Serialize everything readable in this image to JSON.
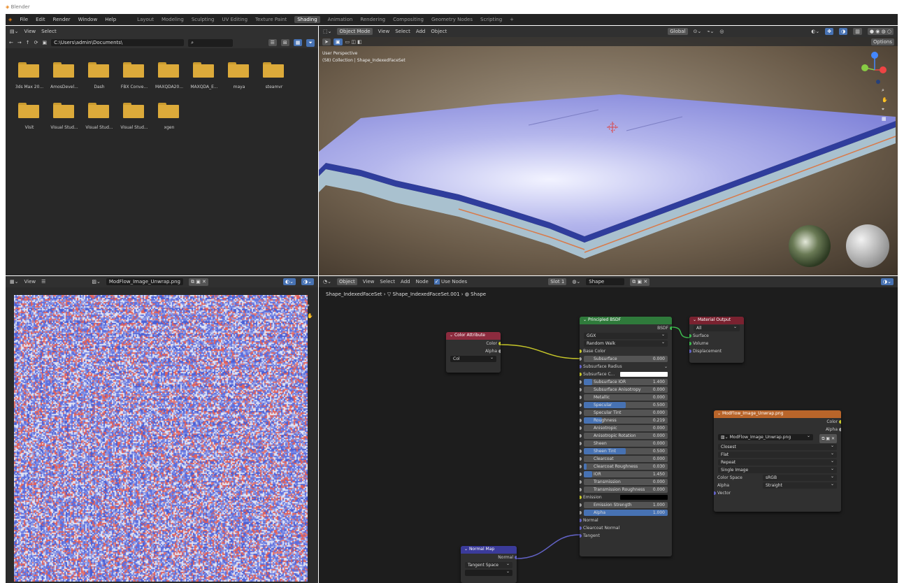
{
  "titlebar": {
    "title": "Blender"
  },
  "menubar": {
    "menus": [
      "File",
      "Edit",
      "Render",
      "Window",
      "Help"
    ],
    "workspaces": [
      "Layout",
      "Modeling",
      "Sculpting",
      "UV Editing",
      "Texture Paint",
      "Shading",
      "Animation",
      "Rendering",
      "Compositing",
      "Geometry Nodes",
      "Scripting",
      "+"
    ],
    "active_workspace": "Shading"
  },
  "file_browser": {
    "header": [
      "View",
      "Select"
    ],
    "path": "C:\\Users\\admin\\Documents\\",
    "folders": [
      "3ds Max 20...",
      "AmosDevel...",
      "Dash",
      "FBX Conve...",
      "MAXQDA20...",
      "MAXQDA_E...",
      "maya",
      "steamvr",
      "Visit",
      "Visual Stud...",
      "Visual Stud...",
      "Visual Stud...",
      "xgen"
    ]
  },
  "viewport": {
    "header": [
      "Object Mode",
      "View",
      "Select",
      "Add",
      "Object"
    ],
    "orientation": "Global",
    "options_label": "Options",
    "overlay_line1": "User Perspective",
    "overlay_line2": "(58) Collection | Shape_IndexedFaceSet",
    "gizmo_axes": [
      "X",
      "Y",
      "Z"
    ]
  },
  "image_editor": {
    "header_view": "View",
    "image_name": "ModFlow_Image_Unwrap.png"
  },
  "node_editor": {
    "header": [
      "Object",
      "View",
      "Select",
      "Add",
      "Node"
    ],
    "use_nodes_label": "Use Nodes",
    "slot": "Slot 1",
    "material": "Shape",
    "breadcrumb": [
      "Shape_IndexedFaceSet",
      "Shape_IndexedFaceSet.001",
      "Shape"
    ],
    "color_attribute": {
      "title": "Color Attribute",
      "outputs": [
        "Color",
        "Alpha"
      ],
      "field": "Col"
    },
    "principled": {
      "title": "Principled BSDF",
      "output": "BSDF",
      "dropdowns": [
        "GGX",
        "Random Walk"
      ],
      "base_color": "Base Color",
      "subsurface_radius": "Subsurface Radius",
      "subsurface_color": "Subsurface C...",
      "params": [
        {
          "label": "Subsurface",
          "value": "0.000",
          "fill": 0
        },
        {
          "label": "Subsurface IOR",
          "value": "1.400",
          "fill": 0.1
        },
        {
          "label": "Subsurface Anisotropy",
          "value": "0.000",
          "fill": 0
        },
        {
          "label": "Metallic",
          "value": "0.000",
          "fill": 0
        },
        {
          "label": "Specular",
          "value": "0.500",
          "fill": 0.5
        },
        {
          "label": "Specular Tint",
          "value": "0.000",
          "fill": 0
        },
        {
          "label": "Roughness",
          "value": "0.219",
          "fill": 0.22
        },
        {
          "label": "Anisotropic",
          "value": "0.000",
          "fill": 0
        },
        {
          "label": "Anisotropic Rotation",
          "value": "0.000",
          "fill": 0
        },
        {
          "label": "Sheen",
          "value": "0.000",
          "fill": 0
        },
        {
          "label": "Sheen Tint",
          "value": "0.500",
          "fill": 0.5
        },
        {
          "label": "Clearcoat",
          "value": "0.000",
          "fill": 0
        },
        {
          "label": "Clearcoat Roughness",
          "value": "0.030",
          "fill": 0.03
        },
        {
          "label": "IOR",
          "value": "1.450",
          "fill": 0.1
        },
        {
          "label": "Transmission",
          "value": "0.000",
          "fill": 0
        },
        {
          "label": "Transmission Roughness",
          "value": "0.000",
          "fill": 0
        }
      ],
      "emission": "Emission",
      "emission_strength": {
        "label": "Emission Strength",
        "value": "1.000",
        "fill": 0
      },
      "alpha": {
        "label": "Alpha",
        "value": "1.000",
        "fill": 1
      },
      "inputs_bottom": [
        "Normal",
        "Clearcoat Normal",
        "Tangent"
      ]
    },
    "material_output": {
      "title": "Material Output",
      "target": "All",
      "inputs": [
        "Surface",
        "Volume",
        "Displacement"
      ]
    },
    "image_texture": {
      "title": "ModFlow_Image_Unwrap.png",
      "outputs": [
        "Color",
        "Alpha"
      ],
      "image": "ModFlow_Image_Unwrap.png",
      "dropdowns": [
        "Closest",
        "Flat",
        "Repeat",
        "Single Image"
      ],
      "color_space_label": "Color Space",
      "color_space": "sRGB",
      "alpha_label": "Alpha",
      "alpha": "Straight",
      "vector": "Vector"
    },
    "normal_map": {
      "title": "Normal Map",
      "output": "Normal",
      "space": "Tangent Space"
    }
  },
  "colors": {
    "bsdf_header": "#2f7a3b",
    "attr_header": "#8c2b3e",
    "output_header": "#7a2230",
    "tex_header": "#b9652a",
    "normal_header": "#3b3b9a",
    "accent": "#4772b3"
  }
}
